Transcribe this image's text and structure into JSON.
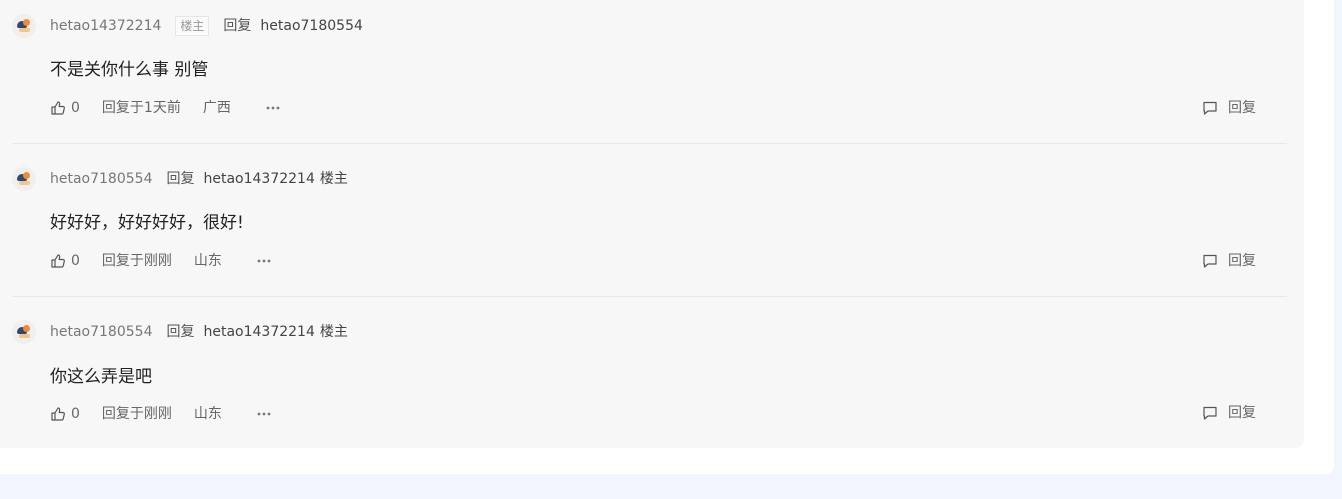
{
  "replies": [
    {
      "username": "hetao14372214",
      "op_tag": "楼主",
      "reply_word": "回复",
      "target": "hetao7180554",
      "content": "不是关你什么事 别管",
      "likes": "0",
      "time": "回复于1天前",
      "location": "广西",
      "reply_label": "回复"
    },
    {
      "username": "hetao7180554",
      "reply_word": "回复",
      "target": "hetao14372214",
      "target_op": "楼主",
      "content": "好好好，好好好好，很好!",
      "likes": "0",
      "time": "回复于刚刚",
      "location": "山东",
      "reply_label": "回复"
    },
    {
      "username": "hetao7180554",
      "reply_word": "回复",
      "target": "hetao14372214",
      "target_op": "楼主",
      "content": "你这么弄是吧",
      "likes": "0",
      "time": "回复于刚刚",
      "location": "山东",
      "reply_label": "回复"
    }
  ],
  "icons": {
    "like": "thumbs-up-icon",
    "more": "more-dots-icon",
    "reply": "comment-icon"
  },
  "colors": {
    "page_background": "#f1f5fd",
    "thread_background": "#f7f7f7",
    "text_muted": "#777777",
    "text_main": "#222222"
  }
}
